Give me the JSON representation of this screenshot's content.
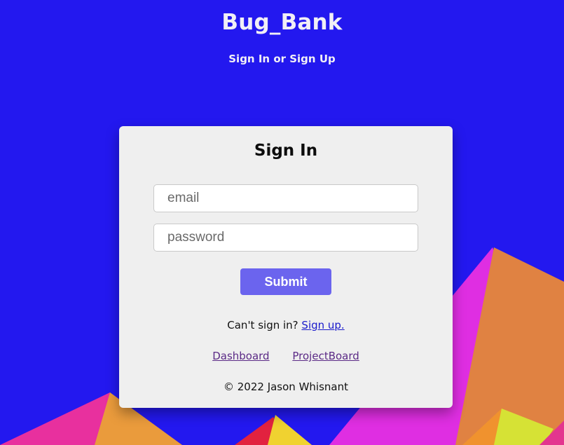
{
  "header": {
    "title": "Bug_Bank",
    "subtitle": "Sign In or Sign Up"
  },
  "signin": {
    "title": "Sign In",
    "email_placeholder": "email",
    "password_placeholder": "password",
    "submit_label": "Submit",
    "prompt_text": "Can't sign in?",
    "signup_link": "Sign up."
  },
  "nav": {
    "dashboard": "Dashboard",
    "projectboard": "ProjectBoard"
  },
  "footer": {
    "copyright": "© 2022 Jason Whisnant"
  },
  "colors": {
    "background": "#2318ef",
    "card": "#efefef",
    "submit_button": "#6b64ee",
    "link": "#1a1acb",
    "visited_link": "#5b2a86"
  }
}
